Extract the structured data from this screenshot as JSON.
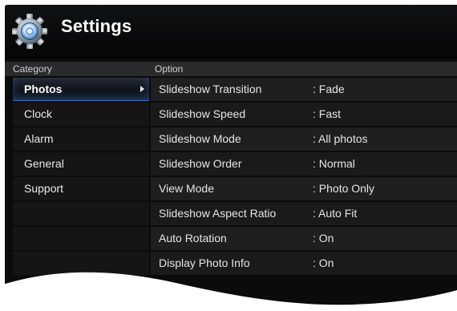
{
  "app": {
    "title": "Settings"
  },
  "headers": {
    "category": "Category",
    "option": "Option"
  },
  "categories": [
    {
      "label": "Photos",
      "selected": true
    },
    {
      "label": "Clock",
      "selected": false
    },
    {
      "label": "Alarm",
      "selected": false
    },
    {
      "label": "General",
      "selected": false
    },
    {
      "label": "Support",
      "selected": false
    },
    {
      "label": "",
      "selected": false
    },
    {
      "label": "",
      "selected": false
    },
    {
      "label": "",
      "selected": false
    }
  ],
  "options": [
    {
      "name": "Slideshow Transition",
      "value": ": Fade"
    },
    {
      "name": "Slideshow Speed",
      "value": ": Fast"
    },
    {
      "name": "Slideshow Mode",
      "value": ": All photos"
    },
    {
      "name": "Slideshow Order",
      "value": ": Normal"
    },
    {
      "name": "View Mode",
      "value": ": Photo Only"
    },
    {
      "name": "Slideshow Aspect Ratio",
      "value": ": Auto Fit"
    },
    {
      "name": "Auto Rotation",
      "value": ": On"
    },
    {
      "name": "Display Photo Info",
      "value": ": On"
    }
  ],
  "colors": {
    "background": "#0b0b0c",
    "selection_accent": "#3c6fb8"
  }
}
